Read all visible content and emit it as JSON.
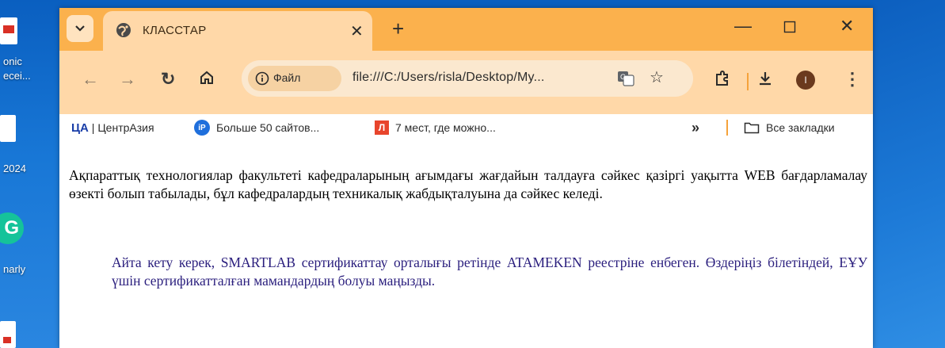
{
  "desktop": {
    "icon_labels": [
      "onic",
      "ecei...",
      "2024",
      "narly"
    ]
  },
  "browser": {
    "tab": {
      "title": "КЛАССТАР"
    },
    "address": {
      "site_chip": "Файл",
      "url": "file:///C:/Users/risla/Desktop/My..."
    },
    "bookmarks": [
      {
        "label": "| ЦентрАзия",
        "icon": "ca-icon",
        "icon_text": "ЦА"
      },
      {
        "label": "Больше 50 сайтов...",
        "icon": "ip-icon",
        "icon_text": "iP"
      },
      {
        "label": "7 мест, где можно...",
        "icon": "l-icon",
        "icon_text": "Л"
      }
    ],
    "bookmarks_overflow": "»",
    "all_bookmarks": "Все закладки",
    "profile_initial": "I"
  },
  "page": {
    "paragraph1": "Ақпараттық технологиялар факультеті кафедраларының ағымдағы жағдайын талдауға сәйкес қазіргі уақытта WEB бағдарламалау өзекті болып табылады, бұл кафедралардың техникалық жабдықталуына да сәйкес келеді.",
    "paragraph2": "Айта кету керек, SMARTLAB сертификаттау орталығы ретінде ATAMEKEN реестріне енбеген. Өздеріңіз білетіндей, ЕҰУ үшін сертификатталған мамандардың болуы маңызды."
  },
  "colors": {
    "tabbar": "#fbb14d",
    "toolbar": "#ffd8a8",
    "paragraph2_text": "#2a1e7d"
  }
}
